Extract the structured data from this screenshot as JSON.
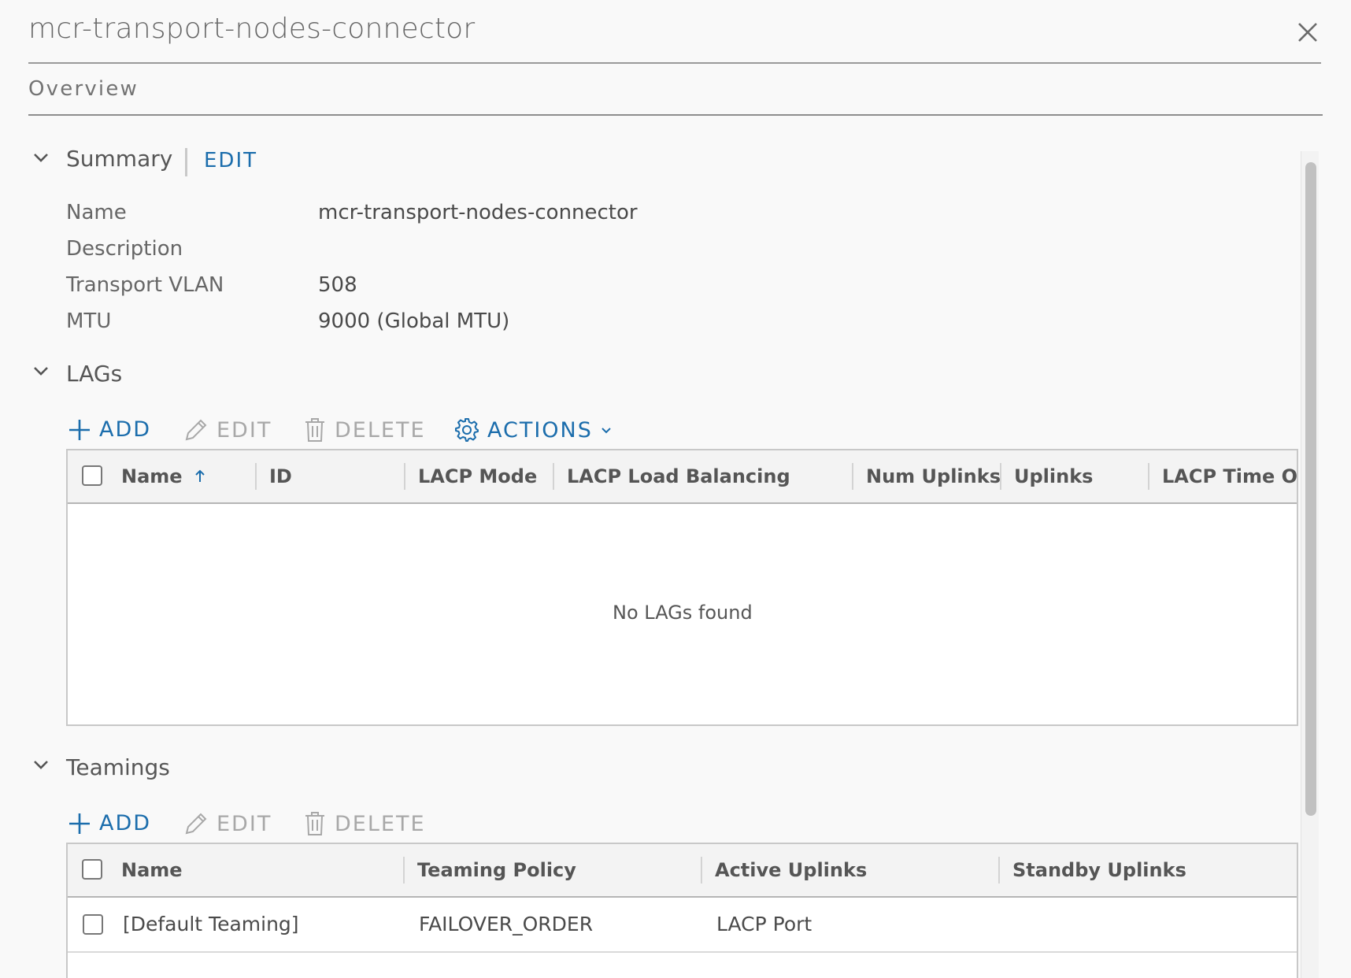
{
  "modal": {
    "title": "mcr-transport-nodes-connector"
  },
  "tabs": [
    {
      "label": "Overview"
    }
  ],
  "summary": {
    "title": "Summary",
    "edit_label": "EDIT",
    "fields": [
      {
        "label": "Name",
        "value": "mcr-transport-nodes-connector"
      },
      {
        "label": "Description",
        "value": ""
      },
      {
        "label": "Transport VLAN",
        "value": "508"
      },
      {
        "label": "MTU",
        "value": "9000 (Global MTU)"
      }
    ]
  },
  "lags": {
    "title": "LAGs",
    "toolbar": {
      "add": "ADD",
      "edit": "EDIT",
      "delete": "DELETE",
      "actions": "ACTIONS"
    },
    "columns": [
      "Name",
      "ID",
      "LACP Mode",
      "LACP Load Balancing",
      "Num Uplinks",
      "Uplinks",
      "LACP Time Ou"
    ],
    "empty_text": "No LAGs found"
  },
  "teamings": {
    "title": "Teamings",
    "toolbar": {
      "add": "ADD",
      "edit": "EDIT",
      "delete": "DELETE"
    },
    "columns": [
      "Name",
      "Teaming Policy",
      "Active Uplinks",
      "Standby Uplinks"
    ],
    "rows": [
      {
        "name": "[Default Teaming]",
        "policy": "FAILOVER_ORDER",
        "active": "LACP Port",
        "standby": ""
      }
    ]
  },
  "colors": {
    "accent": "#1b6dac",
    "text": "#565656",
    "disabled": "#a8a8a8"
  },
  "icons": [
    "close-icon",
    "chevron-down-icon",
    "plus-icon",
    "pencil-icon",
    "trash-icon",
    "gear-icon",
    "sort-asc-icon"
  ]
}
